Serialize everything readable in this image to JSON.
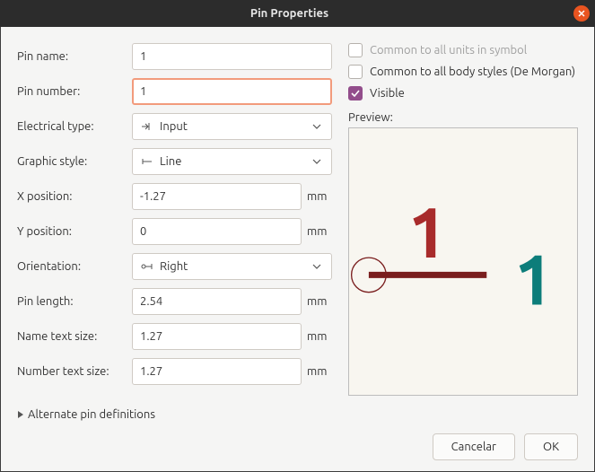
{
  "window": {
    "title": "Pin Properties"
  },
  "form": {
    "pin_name_label": "Pin name:",
    "pin_name_value": "1",
    "pin_number_label": "Pin number:",
    "pin_number_value": "1",
    "electrical_type_label": "Electrical type:",
    "electrical_type_value": "Input",
    "graphic_style_label": "Graphic style:",
    "graphic_style_value": "Line",
    "x_pos_label": "X position:",
    "x_pos_value": "-1.27",
    "y_pos_label": "Y position:",
    "y_pos_value": "0",
    "orientation_label": "Orientation:",
    "orientation_value": "Right",
    "pin_length_label": "Pin length:",
    "pin_length_value": "2.54",
    "name_text_size_label": "Name text size:",
    "name_text_size_value": "1.27",
    "number_text_size_label": "Number text size:",
    "number_text_size_value": "1.27",
    "unit_mm": "mm"
  },
  "right": {
    "common_units_label": "Common to all units in symbol",
    "common_body_label": "Common to all body styles (De Morgan)",
    "visible_label": "Visible",
    "visible_checked": true,
    "preview_label": "Preview:",
    "preview_number": "1",
    "preview_name": "1",
    "colors": {
      "number": "#a82b2b",
      "name": "#0d7d7a",
      "line": "#7a1e1e"
    }
  },
  "alternate_label": "Alternate pin definitions",
  "footer": {
    "cancel": "Cancelar",
    "ok": "OK"
  }
}
